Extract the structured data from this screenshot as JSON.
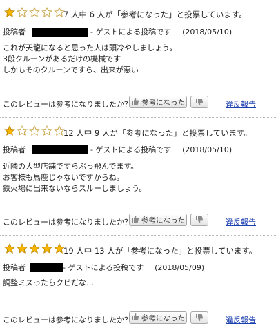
{
  "colors": {
    "star_fill": "#f7b500",
    "star_stroke": "#c08a00",
    "link": "#1a3fb0"
  },
  "ui": {
    "question": "このレビューは参考になりましたか？",
    "helpful_label": "参考になった",
    "report_label": "違反報告",
    "poster_label": "投稿者",
    "guest_text": "- ゲストによる投稿です"
  },
  "reviews": [
    {
      "stars": 1,
      "max_stars": 5,
      "total": "7",
      "helpful": "6",
      "summary": "7 人中 6 人が「参考になった」と投票しています。",
      "date": "(2018/05/10)",
      "body": [
        "これが天龍になると思った人は頭冷やしましょう。",
        "3段クルーンがあるだけの機械です",
        "しかもそのクルーンですら、出来が悪い"
      ]
    },
    {
      "stars": 1,
      "max_stars": 5,
      "total": "12",
      "helpful": "9",
      "summary": "12 人中 9 人が「参考になった」と投票しています。",
      "date": "(2018/05/10)",
      "body": [
        "近隣の大型店舗ですらぶっ飛んでます。",
        "お客様も馬鹿じゃないですからね。",
        "鉄火場に出来ないならスルーしましょう。"
      ]
    },
    {
      "stars": 5,
      "max_stars": 5,
      "total": "19",
      "helpful": "13",
      "summary": "19 人中 13 人が「参考になった」と投票しています。",
      "date": "(2018/05/09)",
      "body": [
        "調整ミスったらクビだな…"
      ]
    }
  ]
}
